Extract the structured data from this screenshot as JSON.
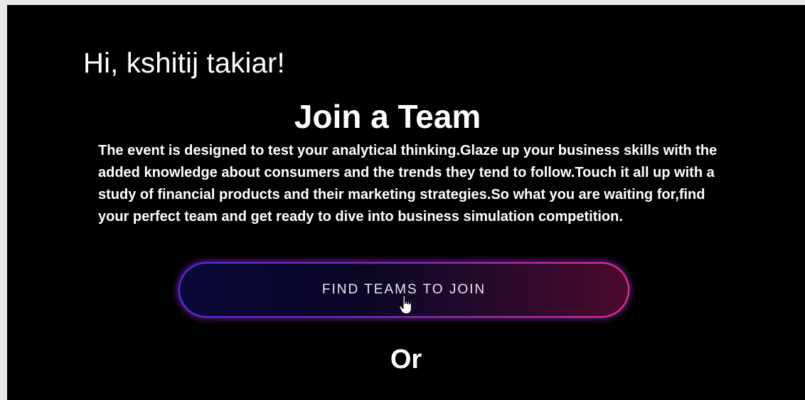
{
  "greeting": "Hi, kshitij takiar!",
  "title": "Join a Team",
  "description": "The event is designed to test your analytical thinking.Glaze up your business skills with the added knowledge about consumers and the trends they tend to follow.Touch it all up with a study of financial products and their marketing strategies.So what you are waiting for,find your perfect team and get ready to dive into business simulation competition.",
  "find_teams_button": {
    "label": "FIND TEAMS TO JOIN"
  },
  "or_label": "Or",
  "icons": {
    "cursor": "hand-pointer-icon"
  },
  "colors": {
    "background": "#000000",
    "text": "#ffffff",
    "button_gradient_start": "#5a2bff",
    "button_gradient_end": "#ff2d94"
  }
}
